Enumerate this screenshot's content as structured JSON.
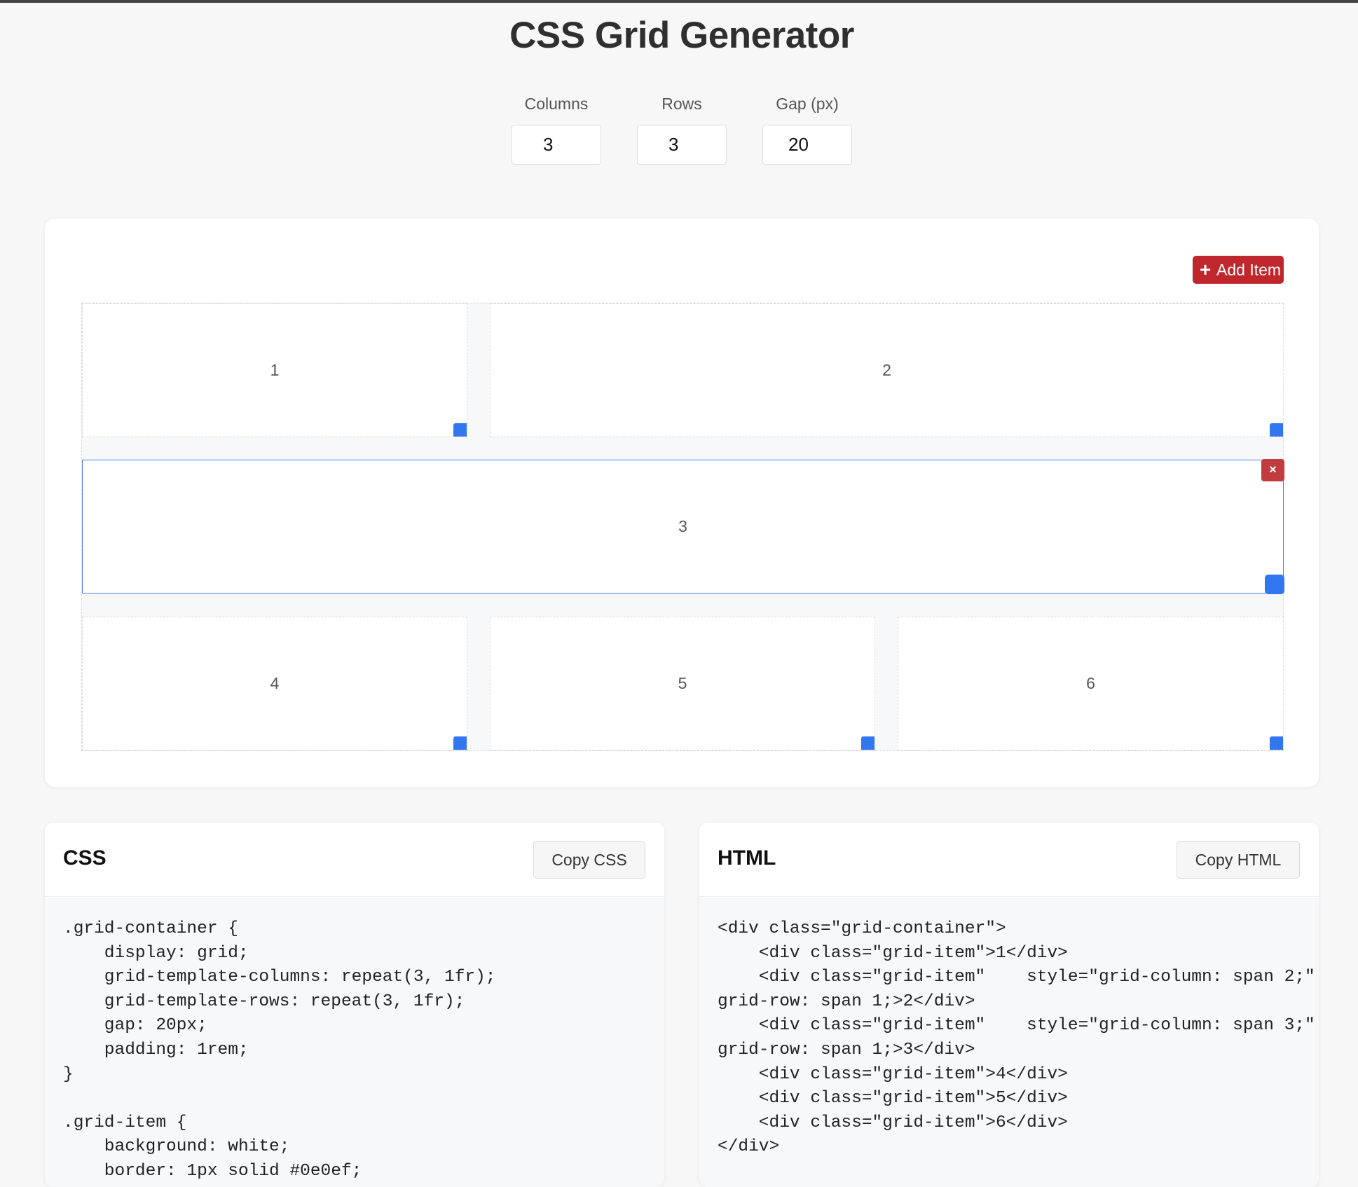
{
  "title": "CSS Grid Generator",
  "controls": {
    "columns": {
      "label": "Columns",
      "value": "3"
    },
    "rows": {
      "label": "Rows",
      "value": "3"
    },
    "gap": {
      "label": "Gap (px)",
      "value": "20"
    }
  },
  "builder": {
    "add_button": {
      "icon": "+",
      "label": "Add Item"
    },
    "remove_icon": "×",
    "items": [
      {
        "label": "1",
        "column_span": 1,
        "row_span": 1
      },
      {
        "label": "2",
        "column_span": 2,
        "row_span": 1
      },
      {
        "label": "3",
        "column_span": 3,
        "row_span": 1,
        "selected": true
      },
      {
        "label": "4",
        "column_span": 1,
        "row_span": 1
      },
      {
        "label": "5",
        "column_span": 1,
        "row_span": 1
      },
      {
        "label": "6",
        "column_span": 1,
        "row_span": 1
      }
    ]
  },
  "css_panel": {
    "title": "CSS",
    "copy_label": "Copy CSS",
    "code": ".grid-container {\n    display: grid;\n    grid-template-columns: repeat(3, 1fr);\n    grid-template-rows: repeat(3, 1fr);\n    gap: 20px;\n    padding: 1rem;\n}\n\n.grid-item {\n    background: white;\n    border: 1px solid #0e0ef;"
  },
  "html_panel": {
    "title": "HTML",
    "copy_label": "Copy HTML",
    "code": "<div class=\"grid-container\">\n    <div class=\"grid-item\">1</div>\n    <div class=\"grid-item\"    style=\"grid-column: span 2;\"\ngrid-row: span 1;>2</div>\n    <div class=\"grid-item\"    style=\"grid-column: span 3;\"\ngrid-row: span 1;>3</div>\n    <div class=\"grid-item\">4</div>\n    <div class=\"grid-item\">5</div>\n    <div class=\"grid-item\">6</div>\n</div>"
  },
  "colors": {
    "accent_red": "#c0272d",
    "handle_blue": "#3377f0",
    "selected_border": "#4a7fe0",
    "background": "#f7f7f8"
  }
}
